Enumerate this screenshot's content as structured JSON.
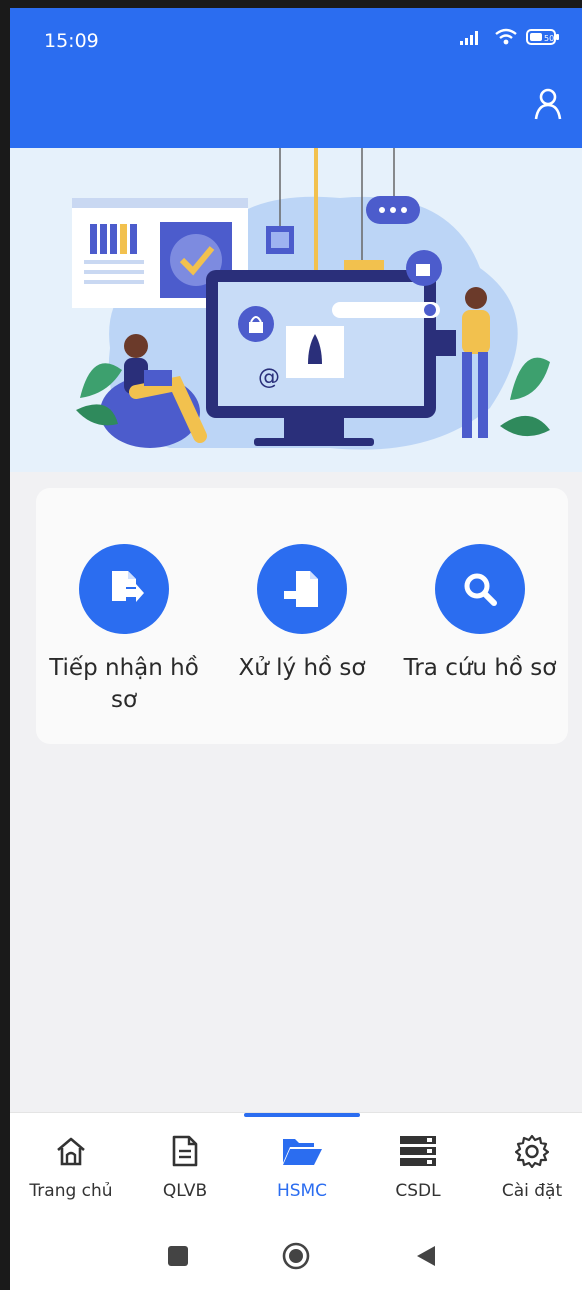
{
  "status_bar": {
    "time": "15:09",
    "battery": "50"
  },
  "header": {
    "profile_icon": "person-icon"
  },
  "hero": {
    "illustration": "workspace-illustration"
  },
  "actions": [
    {
      "label": "Tiếp nhận hồ sơ",
      "icon": "document-export-icon"
    },
    {
      "label": "Xử lý hồ sơ",
      "icon": "document-import-icon"
    },
    {
      "label": "Tra cứu hồ sơ",
      "icon": "search-icon"
    }
  ],
  "bottom_nav": {
    "active_index": 2,
    "items": [
      {
        "label": "Trang chủ",
        "icon": "home-icon"
      },
      {
        "label": "QLVB",
        "icon": "document-icon"
      },
      {
        "label": "HSMC",
        "icon": "folder-open-icon"
      },
      {
        "label": "CSDL",
        "icon": "database-icon"
      },
      {
        "label": "Cài đặt",
        "icon": "settings-icon"
      }
    ]
  },
  "colors": {
    "primary": "#2b6df0",
    "hero_bg": "#e6f1fb",
    "page_bg": "#f1f1f3"
  }
}
